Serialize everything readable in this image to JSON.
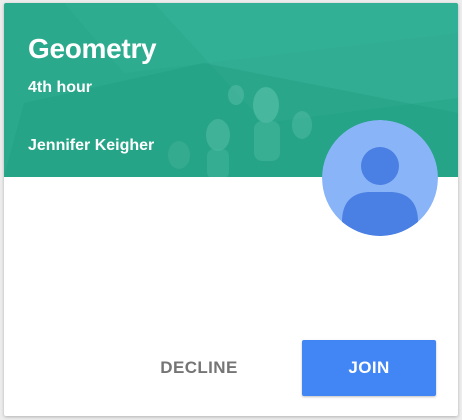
{
  "card": {
    "class_name": "Geometry",
    "section": "4th hour",
    "teacher": "Jennifer Keigher",
    "header_color": "#2aa98d",
    "avatar_icon": "default-user-icon",
    "avatar_bg_color": "#8ab4f8",
    "avatar_fg_color": "#4a7fe3"
  },
  "actions": {
    "decline_label": "DECLINE",
    "join_label": "JOIN",
    "join_color": "#4285f4"
  }
}
